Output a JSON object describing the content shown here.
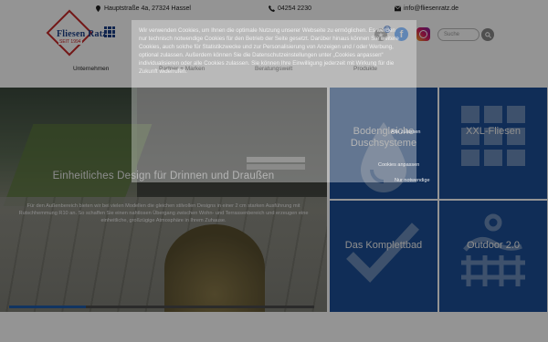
{
  "topbar": {
    "address": "Hauptstraße 4a, 27324 Hassel",
    "phone": "04254 2230",
    "email": "info@fliesenratz.de"
  },
  "logo": {
    "brand_left": "Fliesen",
    "brand_right": "Ratz",
    "since": "SEIT 1994"
  },
  "nav": [
    "Unternehmen",
    "Partner + Marken",
    "Beratungswelt",
    "Produkte"
  ],
  "header": {
    "favorites_count": "0",
    "search_placeholder": "Suche"
  },
  "hero": {
    "title": "Einheitliches Design für Drinnen und Draußen",
    "text": "Für den Außenbereich bieten wir bei vielen Modellen die gleichen stilvollen Designs in einer 2 cm starken Ausführung mit Rutschhemmung R10 an. So schaffen Sie einen nahtlosen Übergang zwischen Wohn- und Terrassenbereich und erzeugen eine einheitliche, großzügige Atmosphäre in Ihrem Zuhause."
  },
  "tiles": [
    {
      "label": "Bodengleiche Duschsysteme"
    },
    {
      "label": "XXL-Fliesen"
    },
    {
      "label": "Das Komplettbad"
    },
    {
      "label": "Outdoor 2.0"
    }
  ],
  "cookie": {
    "text": "Wir verwenden Cookies, um Ihnen die optimale Nutzung unserer Webseite zu ermöglichen. Es werden nur technisch notwendige Cookies für den Betrieb der Seite gesetzt. Darüber hinaus können Sie weitere Cookies, auch solche für Statistikzwecke und zur Personalisierung von Anzeigen und / oder Werbung, optional zulassen. Außerdem können Sie die Datenschutzeinstellungen unter „Cookies anpassen“ individualisieren oder alle Cookies zulassen. Sie können Ihre Einwilligung jederzeit mit Wirkung für die Zukunft widerrufen.",
    "btn_accept": "Alle zulassen",
    "btn_adjust": "Cookies anpassen",
    "btn_necessary": "Nur notwendige"
  },
  "colors": {
    "tile_blue": "#1d4f96",
    "brand_red": "#c62828",
    "brand_blue": "#1a3f87"
  }
}
